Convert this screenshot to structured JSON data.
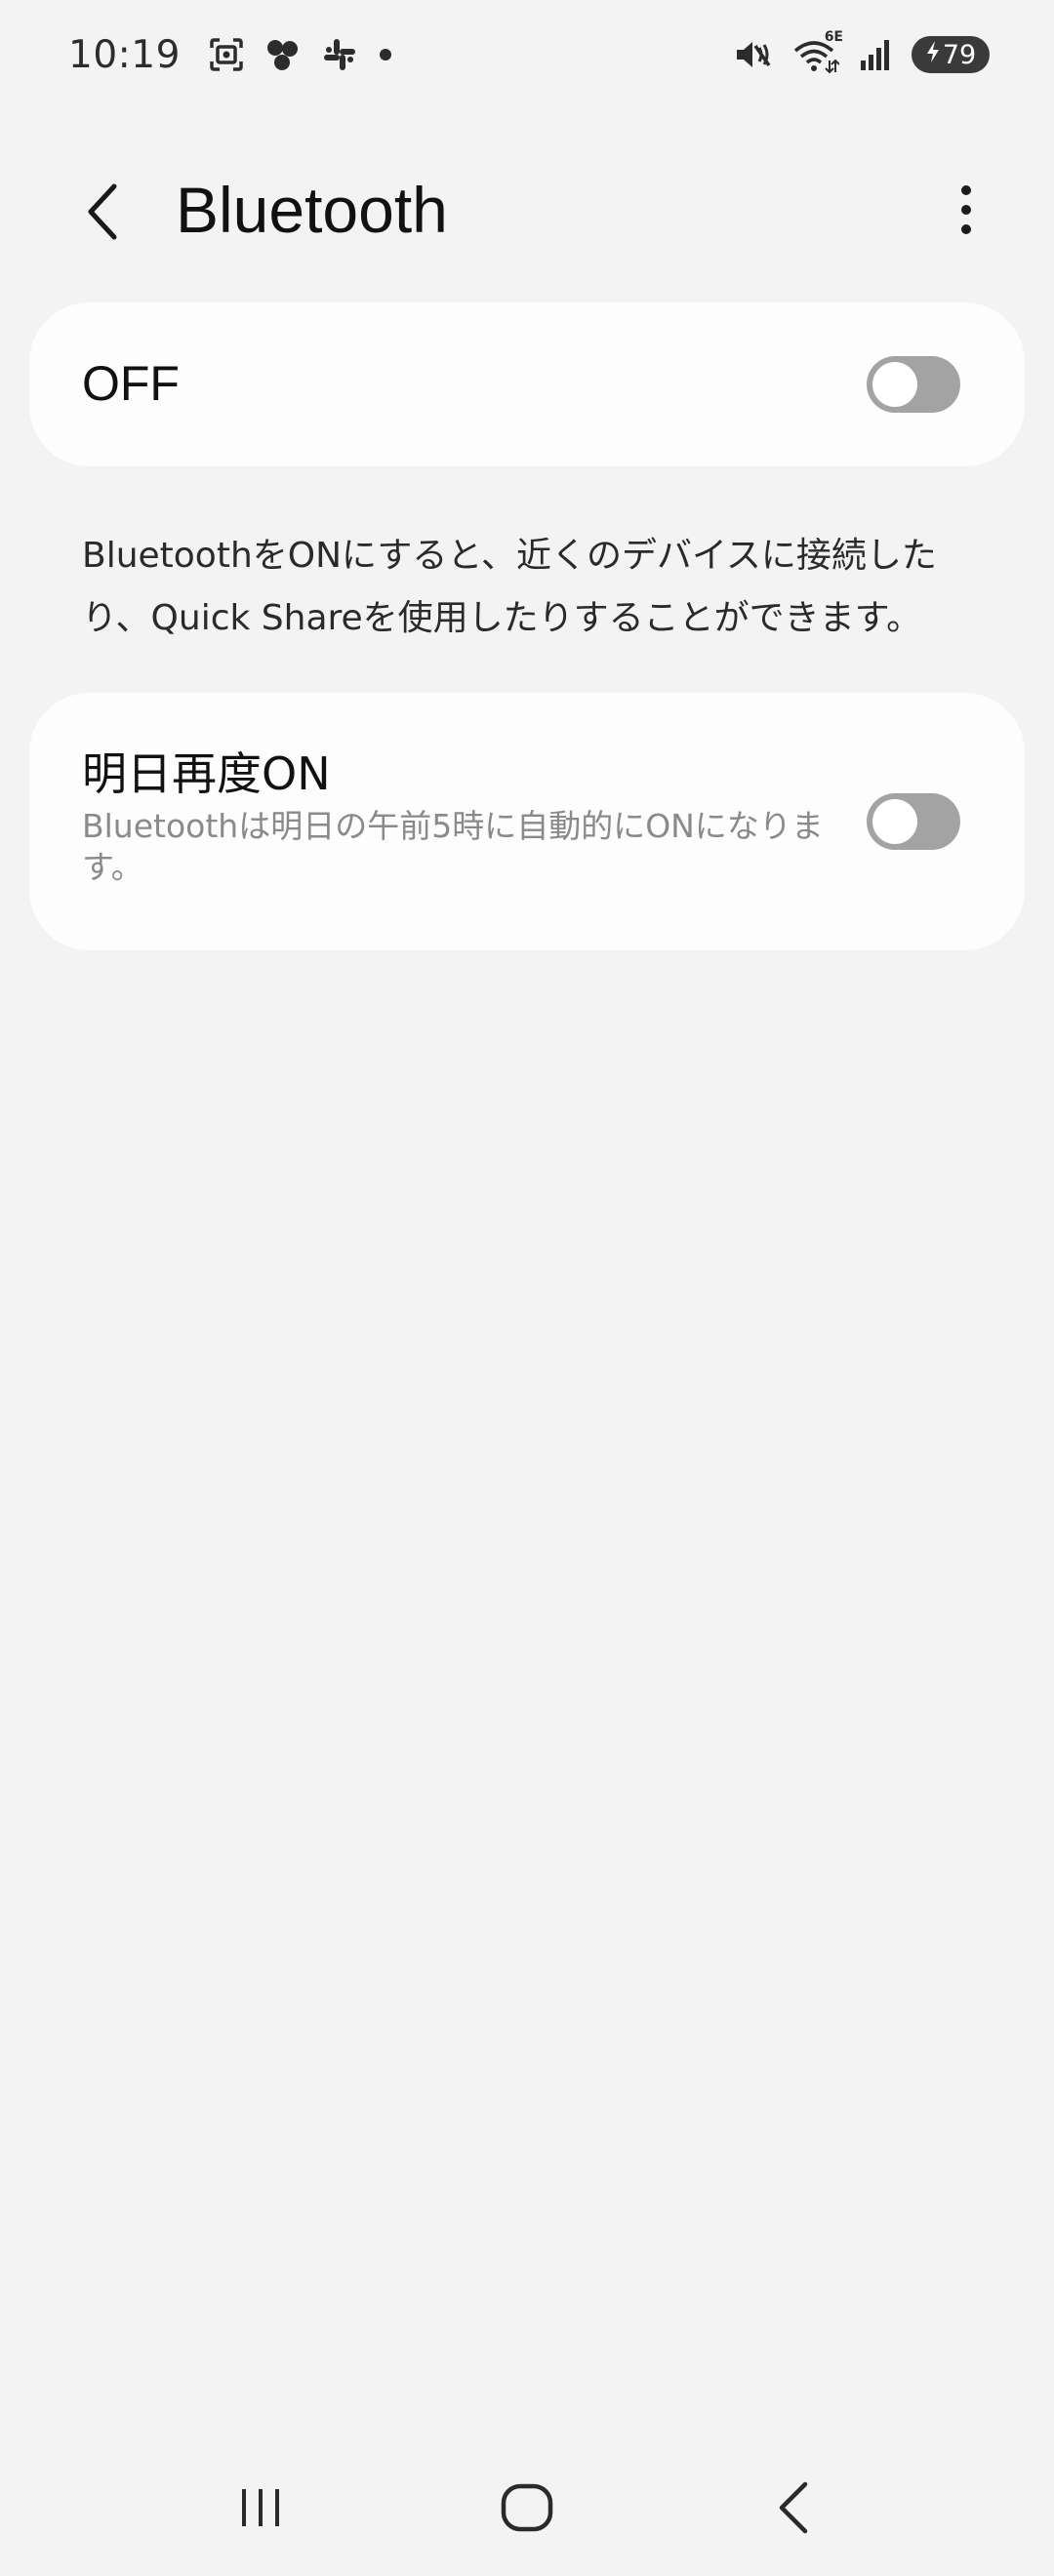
{
  "status_bar": {
    "time": "10:19",
    "left_icons": [
      "screenshot-icon",
      "app-blobs-icon",
      "slack-icon",
      "notification-dot-icon"
    ],
    "right_icons": [
      "mute-vibrate-icon",
      "wifi-6e-icon",
      "cellular-signal-icon"
    ],
    "wifi_badge": "6E",
    "battery_level": "79",
    "battery_charging": true
  },
  "header": {
    "title": "Bluetooth",
    "back_icon": "chevron-left-icon",
    "more_icon": "more-vertical-icon"
  },
  "main_switch": {
    "label": "OFF",
    "state": false
  },
  "description": "BluetoothをONにすると、近くのデバイスに接続したり、Quick Shareを使用したりすることができます。",
  "schedule": {
    "title": "明日再度ON",
    "summary": "Bluetoothは明日の午前5時に自動的にONになります。",
    "state": false
  },
  "colors": {
    "background": "#f3f3f3",
    "card": "#fdfdfd",
    "toggle_off": "#a3a3a3",
    "secondary_text": "#8a8a8a"
  },
  "nav_bar": {
    "icons": [
      "recent-apps-icon",
      "home-icon",
      "back-icon"
    ]
  }
}
